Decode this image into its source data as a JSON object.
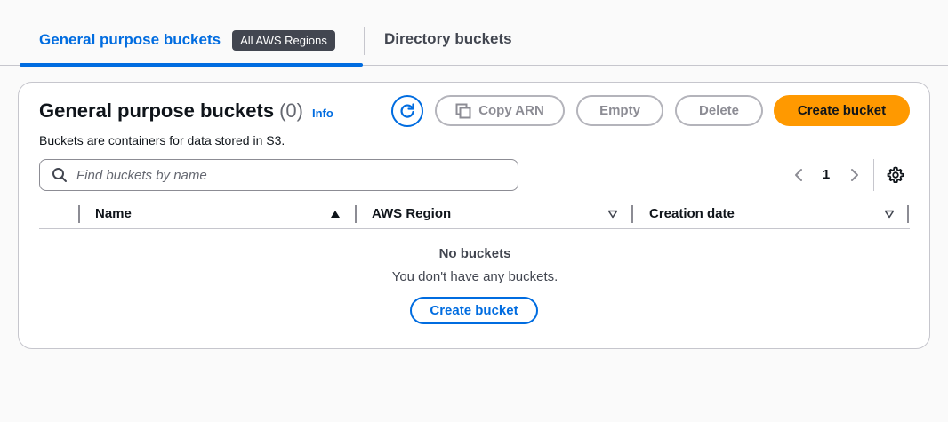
{
  "tabs": {
    "general": {
      "label": "General purpose buckets",
      "badge": "All AWS Regions"
    },
    "directory": {
      "label": "Directory buckets"
    }
  },
  "header": {
    "title": "General purpose buckets",
    "count": "(0)",
    "info": "Info",
    "description": "Buckets are containers for data stored in S3."
  },
  "actions": {
    "refresh_icon": "refresh-icon",
    "copy_arn": "Copy ARN",
    "empty": "Empty",
    "delete": "Delete",
    "create_bucket": "Create bucket"
  },
  "search": {
    "placeholder": "Find buckets by name",
    "value": ""
  },
  "pagination": {
    "current_page": "1"
  },
  "table": {
    "columns": [
      {
        "label": "Name",
        "sort": "ascending"
      },
      {
        "label": "AWS Region",
        "sort": "none"
      },
      {
        "label": "Creation date",
        "sort": "none"
      }
    ],
    "rows": []
  },
  "empty_state": {
    "title": "No buckets",
    "description": "You don't have any buckets.",
    "button": "Create bucket"
  },
  "colors": {
    "accent": "#006ce0",
    "primary_button": "#ff9900",
    "badge_bg": "#424650",
    "disabled": "#8c8c94"
  }
}
